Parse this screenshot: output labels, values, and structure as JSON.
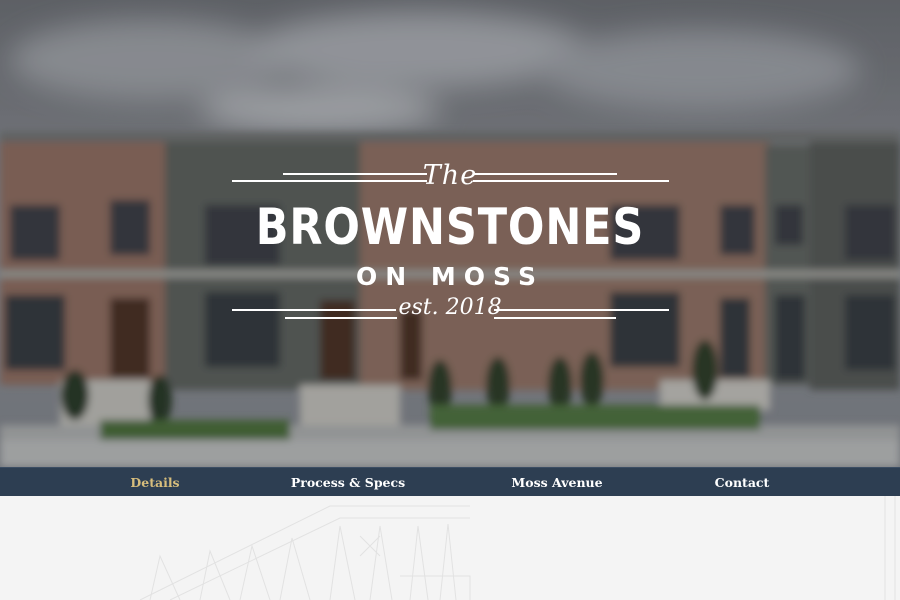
{
  "logo": {
    "the": "The",
    "brand": "BROWNSTONES",
    "sub": "ON MOSS",
    "est": "est. 2018"
  },
  "nav": {
    "items": [
      {
        "label": "Details",
        "active": true
      },
      {
        "label": "Process & Specs",
        "active": false
      },
      {
        "label": "Moss Avenue",
        "active": false
      },
      {
        "label": "Contact",
        "active": false
      }
    ]
  },
  "colors": {
    "nav_background": "#2d3e52",
    "nav_active": "#d8be7c",
    "nav_text": "#ffffff",
    "content_background": "#f4f4f4"
  }
}
